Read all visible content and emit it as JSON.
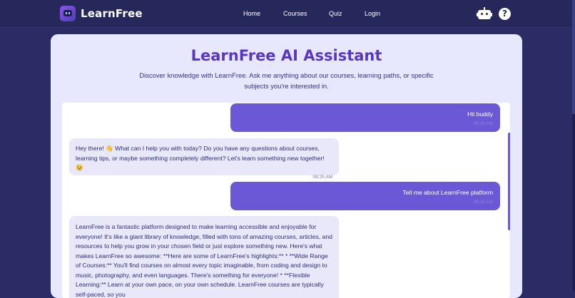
{
  "brand": {
    "name": "LearnFree",
    "logo_icon": "robot-logo-icon"
  },
  "nav": {
    "home": "Home",
    "courses": "Courses",
    "quiz": "Quiz",
    "login": "Login"
  },
  "header_icons": {
    "robot": "robot-icon",
    "help": "?"
  },
  "main": {
    "title": "LearnFree AI Assistant",
    "subtitle": "Discover knowledge with LearnFree. Ask me anything about our courses, learning paths, or specific subjects you're interested in."
  },
  "messages": [
    {
      "role": "user",
      "text": "Hii buddy",
      "time": "09:25 AM"
    },
    {
      "role": "bot",
      "text": "Hey there! 👋 What can I help you with today? Do you have any questions about courses, learning tips, or maybe something completely different? Let's learn something new together! 😉",
      "time": "09:25 AM"
    },
    {
      "role": "user",
      "text": "Tell me about LearnFree platform",
      "time": "09:26 AM"
    },
    {
      "role": "bot",
      "text": "LearnFree is a fantastic platform designed to make learning accessible and enjoyable for everyone! It's like a giant library of knowledge, filled with tons of amazing courses, articles, and resources to help you grow in your chosen field or just explore something new. Here's what makes LearnFree so awesome: **Here are some of LearnFree's highlights:** * **Wide Range of Courses:** You'll find courses on almost every topic imaginable, from coding and design to music, photography, and even languages. There's something for everyone! * **Flexible Learning:** Learn at your own pace, on your own schedule. LearnFree courses are typically self-paced, so you",
      "time": ""
    }
  ],
  "colors": {
    "background": "#2b2c66",
    "card": "#e7e8fd",
    "accent": "#5a36c4",
    "user_bubble": "#6a58d6",
    "bot_bubble": "#e9e8fb"
  }
}
